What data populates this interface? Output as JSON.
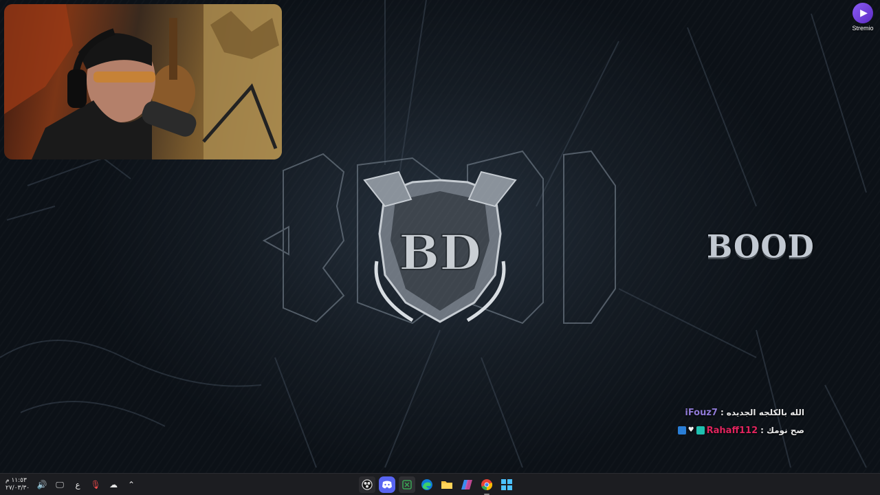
{
  "desktop": {
    "shortcut": {
      "label": "Stremio",
      "icon": "stremio-play-icon",
      "color": "#7b45e0"
    },
    "logo_text": "BOOD"
  },
  "chat": [
    {
      "user": "iFouz7",
      "separator": ":",
      "message": "الله بالكلجه الجديده",
      "user_color": "#8f7ad6"
    },
    {
      "user": "Rahaff112",
      "separator": ":",
      "message": "صح نومك",
      "user_color": "#e0245e"
    }
  ],
  "taskbar": {
    "clock": {
      "time": "١١:٥٣ م",
      "date": "٢٧/٠٣/٣٠"
    },
    "language": "ع",
    "tray_icons": [
      "volume-icon",
      "display-icon",
      "mic-icon",
      "cloud-icon",
      "chevron-up-icon"
    ],
    "apps": [
      {
        "name": "obs",
        "icon": "obs-icon",
        "color": "#2a2a2e"
      },
      {
        "name": "discord",
        "icon": "discord-icon",
        "color": "#5865f2"
      },
      {
        "name": "xbox",
        "icon": "xbox-icon",
        "color": "#2f2f33"
      },
      {
        "name": "edge",
        "icon": "edge-icon",
        "color": "#0f7bd8"
      },
      {
        "name": "file-explorer",
        "icon": "folder-icon",
        "color": "#f5c242"
      },
      {
        "name": "copilot",
        "icon": "copilot-icon",
        "color": "#d94fa5"
      },
      {
        "name": "chrome",
        "icon": "chrome-icon",
        "color": "#e94235"
      },
      {
        "name": "start",
        "icon": "windows-icon",
        "color": "#4cc2ff"
      }
    ]
  }
}
